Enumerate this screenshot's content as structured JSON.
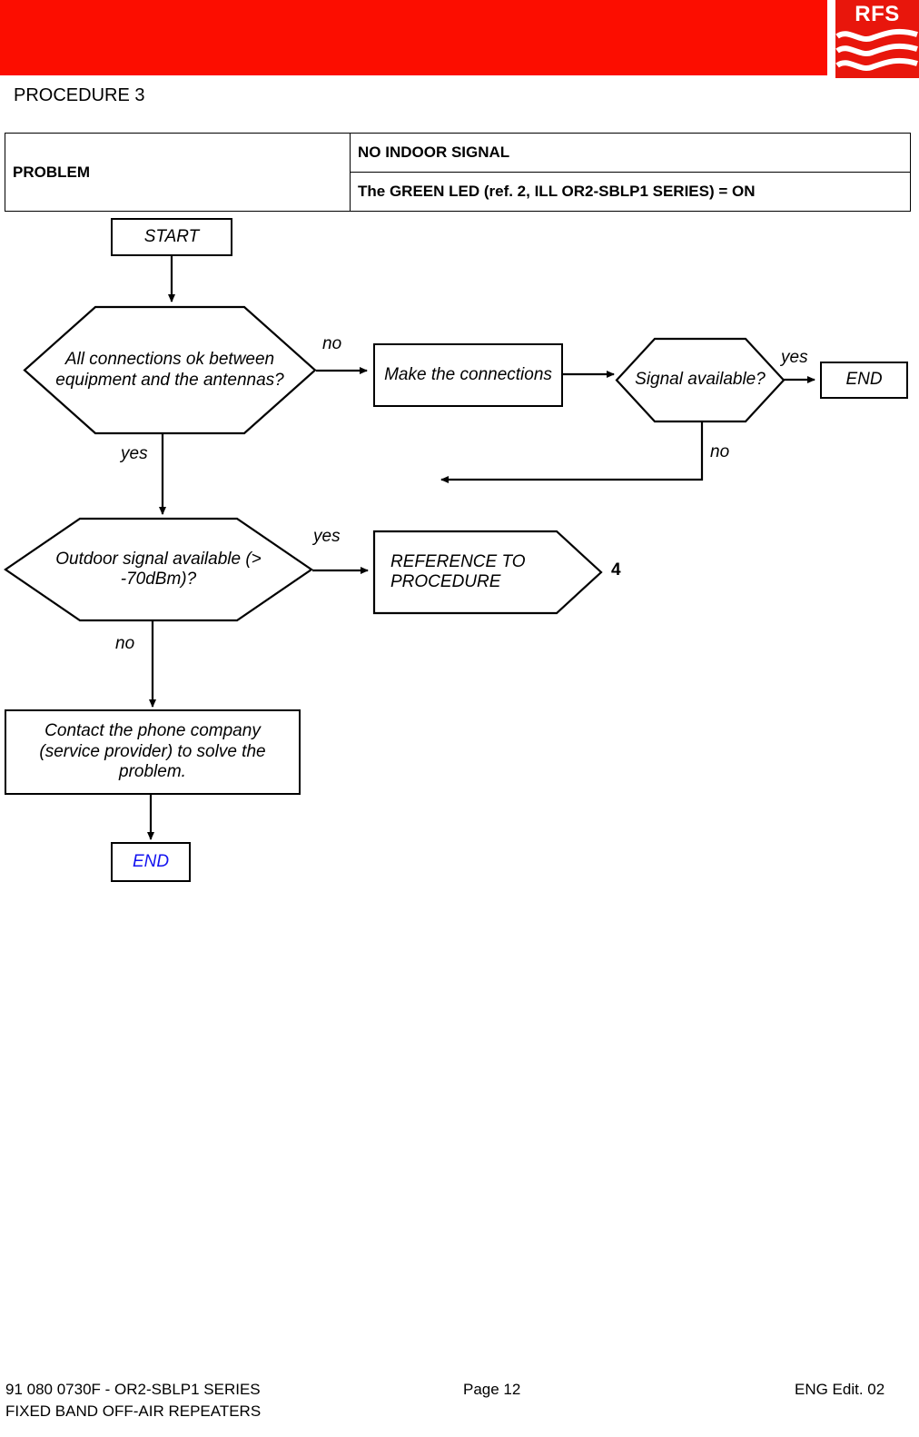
{
  "header": {
    "logo_text": "RFS",
    "logo_icon": "rfs-waves-icon",
    "bar_color": "#FC0D00",
    "procedure_title": "PROCEDURE 3"
  },
  "problem_table": {
    "label": "PROBLEM",
    "rows": [
      "NO INDOOR SIGNAL",
      "The GREEN LED (ref. 2, ILL OR2-SBLP1 SERIES) = ON"
    ]
  },
  "flowchart": {
    "nodes": {
      "start": "START",
      "decision_connections": "All connections ok between equipment and the antennas?",
      "make_connections": "Make the connections",
      "decision_signal": "Signal available?",
      "end_top": "END",
      "decision_outdoor": "Outdoor signal available (> -70dBm)?",
      "reference_procedure": "REFERENCE TO PROCEDURE",
      "reference_number": "4",
      "contact_provider": "Contact the phone company (service provider) to solve the problem.",
      "end_bottom": "END"
    },
    "edge_labels": {
      "connections_no": "no",
      "connections_yes": "yes",
      "signal_yes": "yes",
      "signal_no": "no",
      "outdoor_yes": "yes",
      "outdoor_no": "no"
    },
    "colors": {
      "end_bottom_text": "#1414F0",
      "line": "#000000"
    }
  },
  "footer": {
    "left_line1": "91 080 0730F - OR2-SBLP1 SERIES",
    "left_line2": "FIXED BAND OFF-AIR REPEATERS",
    "center": "Page 12",
    "right": "ENG Edit. 02"
  }
}
